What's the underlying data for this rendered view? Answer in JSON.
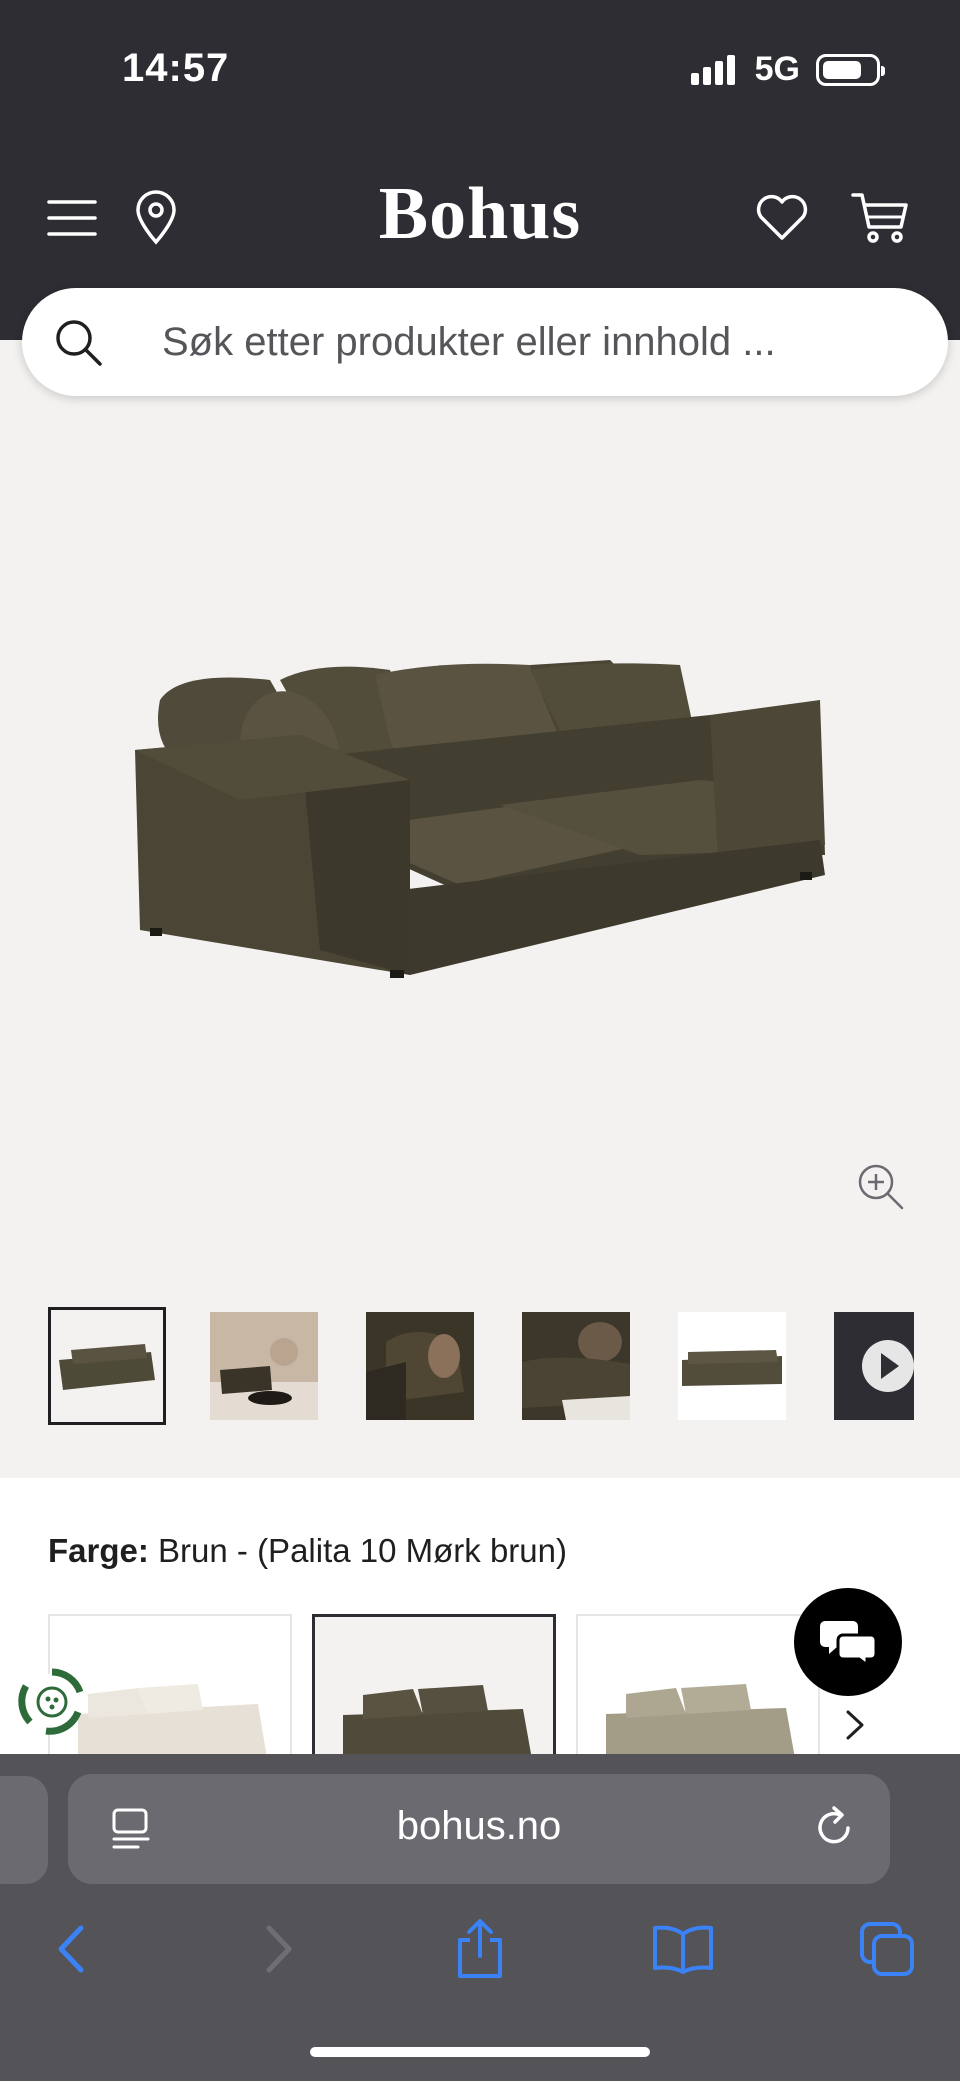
{
  "status_bar": {
    "time": "14:57",
    "network": "5G"
  },
  "header": {
    "logo": "Bohus",
    "icons": [
      "menu-icon",
      "location-pin-icon",
      "heart-icon",
      "cart-icon"
    ],
    "background": "#2e2d33"
  },
  "search": {
    "placeholder": "Søk etter produkter eller innhold ..."
  },
  "gallery": {
    "thumbnail_count": 6,
    "selected_thumbnail": 1,
    "last_thumbnail": "video",
    "background": "#f4f2f0"
  },
  "color": {
    "label": "Farge:",
    "value": "Brun - (Palita 10 Mørk brun)",
    "options": [
      {
        "color": "#e6e0d6",
        "selected": false
      },
      {
        "color": "#4f4a39",
        "selected": true
      },
      {
        "color": "#a39c86",
        "selected": false
      }
    ]
  },
  "browser": {
    "url": "bohus.no"
  },
  "colors": {
    "accent_blue": "#3b82f6",
    "sofa_brown": "#4e4a38"
  }
}
